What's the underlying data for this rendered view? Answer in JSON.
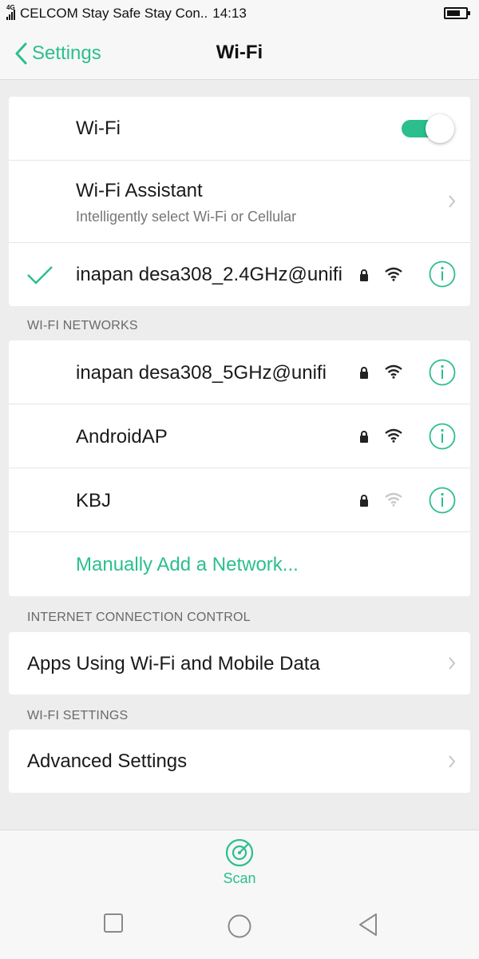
{
  "status_bar": {
    "network_tag": "4G",
    "carrier_text": "CELCOM Stay Safe Stay Con..",
    "time": "14:13"
  },
  "header": {
    "back_label": "Settings",
    "title": "Wi-Fi"
  },
  "wifi_card": {
    "wifi_label": "Wi-Fi",
    "wifi_enabled": true,
    "assistant_label": "Wi-Fi Assistant",
    "assistant_sub": "Intelligently select Wi-Fi or Cellular",
    "connected_network": "inapan desa308_2.4GHz@unifi"
  },
  "networks_section": {
    "header": "WI-FI NETWORKS",
    "networks": [
      {
        "name": "inapan desa308_5GHz@unifi",
        "locked": true,
        "signal": "strong"
      },
      {
        "name": "AndroidAP",
        "locked": true,
        "signal": "strong"
      },
      {
        "name": "KBJ",
        "locked": true,
        "signal": "weak"
      }
    ],
    "add_network_label": "Manually Add a Network..."
  },
  "internet_section": {
    "header": "INTERNET CONNECTION CONTROL",
    "item_label": "Apps Using Wi-Fi and Mobile Data"
  },
  "settings_section": {
    "header": "WI-FI SETTINGS",
    "item_label": "Advanced Settings"
  },
  "scan": {
    "label": "Scan"
  },
  "colors": {
    "accent": "#2bbf8e",
    "background": "#ededed",
    "card": "#ffffff"
  },
  "icons": [
    "back-chevron-icon",
    "check-icon",
    "lock-icon",
    "wifi-signal-icon",
    "info-icon",
    "chevron-right-icon",
    "scan-icon",
    "square-icon",
    "circle-icon",
    "triangle-back-icon"
  ]
}
